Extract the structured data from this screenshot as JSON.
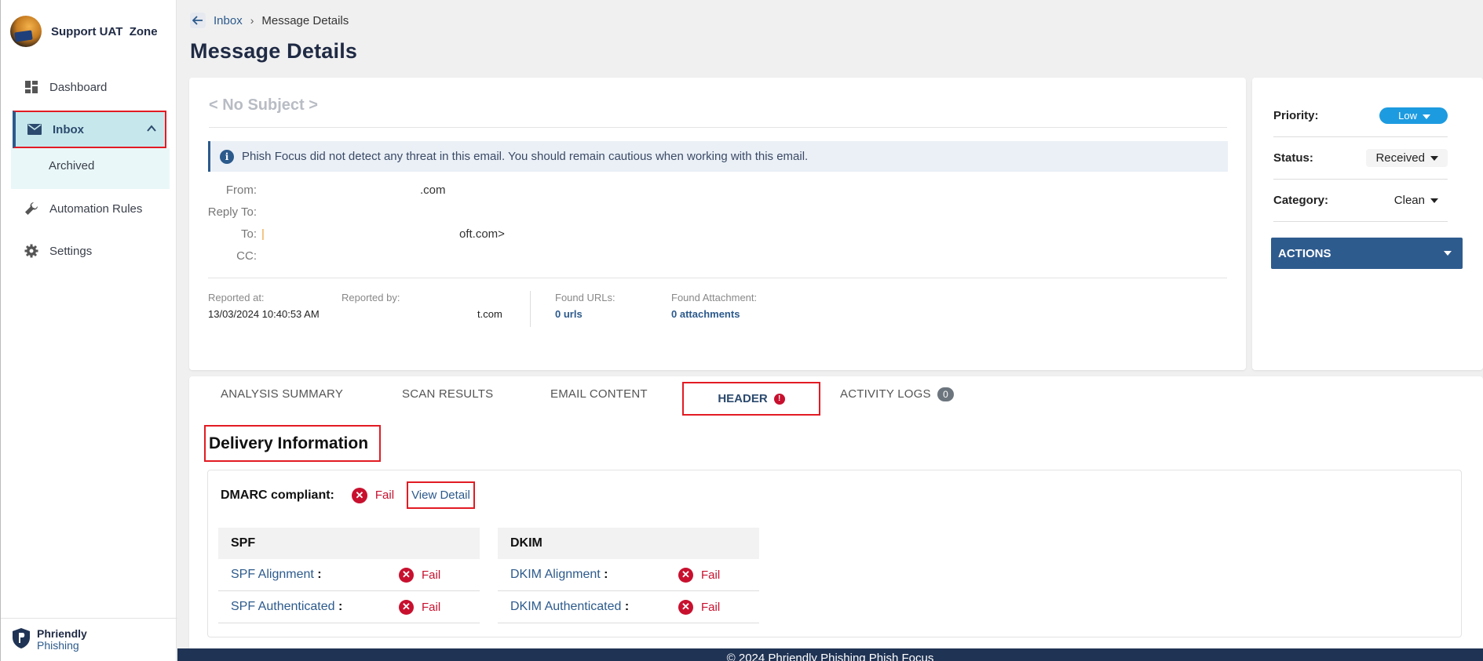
{
  "sidebar": {
    "org_name": "Support UAT  Zone",
    "items": [
      {
        "label": "Dashboard",
        "icon": "dashboard-icon"
      },
      {
        "label": "Inbox",
        "icon": "mail-icon"
      },
      {
        "label": "Archived"
      },
      {
        "label": "Automation Rules",
        "icon": "wrench-icon"
      },
      {
        "label": "Settings",
        "icon": "gear-icon"
      }
    ],
    "logo_line1": "Phriendly",
    "logo_line2": "Phishing"
  },
  "breadcrumb": {
    "parent": "Inbox",
    "current": "Message Details"
  },
  "page_title": "Message Details",
  "message": {
    "subject": "< No Subject >",
    "alert": "Phish Focus did not detect any threat in this email. You should remain cautious when working with this email.",
    "from_label": "From:",
    "from_value": ".com",
    "reply_to_label": "Reply To:",
    "to_label": "To:",
    "to_value": "oft.com>",
    "cc_label": "CC:",
    "reported_at_label": "Reported at:",
    "reported_at_value": "13/03/2024 10:40:53 AM",
    "reported_by_label": "Reported by:",
    "reported_by_value": "t.com",
    "found_urls_label": "Found URLs:",
    "found_urls_value": "0 urls",
    "found_attachment_label": "Found Attachment:",
    "found_attachment_value": "0 attachments"
  },
  "side": {
    "priority_label": "Priority:",
    "priority_value": "Low",
    "priority_color": "#1d9be0",
    "status_label": "Status:",
    "status_value": "Received",
    "category_label": "Category:",
    "category_value": "Clean",
    "actions_label": "ACTIONS"
  },
  "tabs": [
    {
      "label": "ANALYSIS SUMMARY"
    },
    {
      "label": "SCAN RESULTS"
    },
    {
      "label": "EMAIL CONTENT"
    },
    {
      "label": "HEADER",
      "active": true,
      "badge": "!"
    },
    {
      "label": "ACTIVITY LOGS",
      "badge": "0"
    }
  ],
  "delivery": {
    "title": "Delivery Information",
    "dmarc_label": "DMARC compliant:",
    "dmarc_value": "Fail",
    "view_detail": "View Detail",
    "spf": {
      "title": "SPF",
      "rows": [
        {
          "key": "SPF Alignment",
          "value": "Fail"
        },
        {
          "key": "SPF Authenticated",
          "value": "Fail"
        }
      ]
    },
    "dkim": {
      "title": "DKIM",
      "rows": [
        {
          "key": "DKIM Alignment",
          "value": "Fail"
        },
        {
          "key": "DKIM Authenticated",
          "value": "Fail"
        }
      ]
    },
    "fail_color": "#c8102e"
  },
  "footer": "© 2024 Phriendly Phishing Phish Focus"
}
